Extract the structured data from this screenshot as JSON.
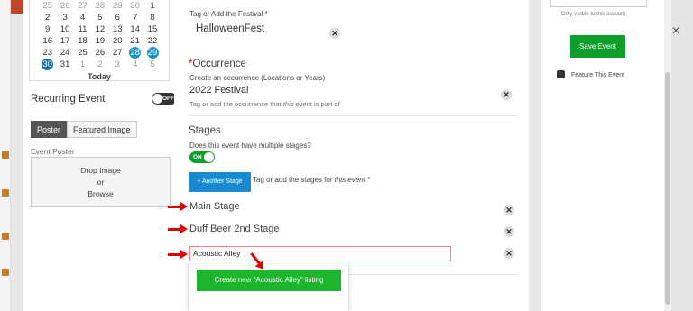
{
  "calendar": {
    "rows": [
      [
        "25",
        "26",
        "27",
        "28",
        "29",
        "30",
        "1"
      ],
      [
        "2",
        "3",
        "4",
        "5",
        "6",
        "7",
        "8"
      ],
      [
        "9",
        "10",
        "11",
        "12",
        "13",
        "14",
        "15"
      ],
      [
        "16",
        "17",
        "18",
        "19",
        "20",
        "21",
        "22"
      ],
      [
        "23",
        "24",
        "25",
        "26",
        "27",
        "28",
        "29"
      ],
      [
        "30",
        "31",
        "1",
        "2",
        "3",
        "4",
        "5"
      ]
    ],
    "today_label": "Today"
  },
  "recurring": {
    "label": "Recurring Event",
    "toggle_text": "OFF"
  },
  "media_tabs": {
    "poster": "Poster",
    "featured": "Featured Image"
  },
  "poster": {
    "label": "Event Poster",
    "drop_line1": "Drop Image",
    "drop_line2": "or",
    "drop_line3": "Browse"
  },
  "festival": {
    "label": "Tag or Add the Festival",
    "required_mark": "*",
    "value": "HalloweenFest"
  },
  "occurrence": {
    "title": "Occurrence",
    "required_mark": "*",
    "label": "Create an occurrence (Locations or Years)",
    "value": "2022 Festival",
    "hint_pre": "Tag or add the occurrence that ",
    "hint_em": "this",
    "hint_post": " event is part of"
  },
  "stages": {
    "title": "Stages",
    "question": "Does this event have multiple stages?",
    "toggle_text": "ON",
    "add_button": "+ Another Stage",
    "hint_pre": "Tag or add the stages for ",
    "hint_em": "this event",
    "hint_req": " *",
    "items": [
      "Main Stage",
      "Duff Beer 2nd Stage"
    ],
    "input_value": "Acoustic Alley",
    "create_button": "Create new \"Acoustic Alley\" listing"
  },
  "sidebar": {
    "only_visible": "Only visible to this account",
    "save_button": "Save Event",
    "feature_label": "Feature This Event"
  },
  "icons": {
    "remove": "close-circle-icon",
    "arrow": "red-arrow-icon",
    "close": "close-icon"
  },
  "colors": {
    "accent_blue": "#1a8ad0",
    "green": "#0f9d2c",
    "create_green": "#1db52b",
    "arrow_red": "#e00000"
  }
}
